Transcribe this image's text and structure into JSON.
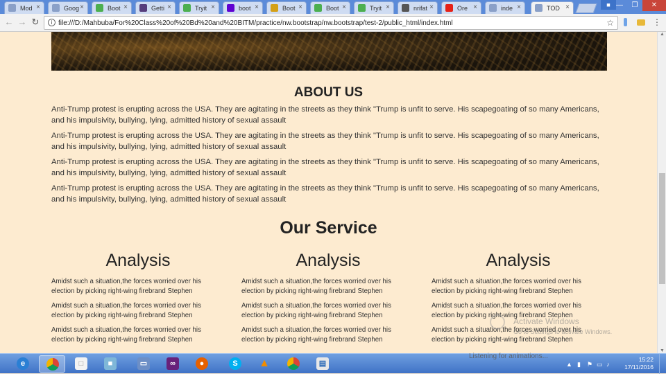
{
  "browser": {
    "tabs": [
      {
        "label": "Mod",
        "icon": "page-icon",
        "color": "#8aa0c8"
      },
      {
        "label": "Goog",
        "icon": "page-icon",
        "color": "#8aa0c8"
      },
      {
        "label": "Boot",
        "icon": "w3schools-icon",
        "color": "#4caf50"
      },
      {
        "label": "Getti",
        "icon": "bootstrap-icon",
        "color": "#563d7c"
      },
      {
        "label": "Tryit",
        "icon": "w3schools-icon",
        "color": "#4caf50"
      },
      {
        "label": "boot",
        "icon": "yahoo-icon",
        "color": "#5f01d1"
      },
      {
        "label": "Boot",
        "icon": "coin-icon",
        "color": "#d4a017"
      },
      {
        "label": "Boot",
        "icon": "w3schools-icon",
        "color": "#4caf50"
      },
      {
        "label": "Tryit",
        "icon": "w3schools-icon",
        "color": "#4caf50"
      },
      {
        "label": "nrifat",
        "icon": "github-icon",
        "color": "#555"
      },
      {
        "label": "Ore",
        "icon": "youtube-icon",
        "color": "#e62117"
      },
      {
        "label": "inde",
        "icon": "page-icon",
        "color": "#8aa0c8"
      },
      {
        "label": "TOD",
        "icon": "page-icon",
        "color": "#8aa0c8"
      }
    ],
    "url": "file:///D:/Mahbuba/For%20Class%20of%20Bd%20and%20BITM/practice/nw.bootstrap/nw.bootstrap/test-2/public_html/index.html"
  },
  "about": {
    "title": "ABOUT US",
    "paragraphs": [
      "Anti-Trump protest is erupting across the USA. They are agitating in the streets as they think \"Trump is unfit to serve. His scapegoating of so many Americans, and his impulsivity, bullying, lying, admitted history of sexual assault",
      "Anti-Trump protest is erupting across the USA. They are agitating in the streets as they think \"Trump is unfit to serve. His scapegoating of so many Americans, and his impulsivity, bullying, lying, admitted history of sexual assault",
      "Anti-Trump protest is erupting across the USA. They are agitating in the streets as they think \"Trump is unfit to serve. His scapegoating of so many Americans, and his impulsivity, bullying, lying, admitted history of sexual assault",
      "Anti-Trump protest is erupting across the USA. They are agitating in the streets as they think \"Trump is unfit to serve. His scapegoating of so many Americans, and his impulsivity, bullying, lying, admitted history of sexual assault"
    ]
  },
  "service": {
    "title": "Our Service",
    "columns": [
      {
        "heading": "Analysis",
        "items": [
          "Amidst such a situation,the forces worried over his election by picking right-wing firebrand Stephen",
          "Amidst such a situation,the forces worried over his election by picking right-wing firebrand Stephen",
          "Amidst such a situation,the forces worried over his election by picking right-wing firebrand Stephen"
        ]
      },
      {
        "heading": "Analysis",
        "items": [
          "Amidst such a situation,the forces worried over his election by picking right-wing firebrand Stephen",
          "Amidst such a situation,the forces worried over his election by picking right-wing firebrand Stephen",
          "Amidst such a situation,the forces worried over his election by picking right-wing firebrand Stephen"
        ]
      },
      {
        "heading": "Analysis",
        "items": [
          "Amidst such a situation,the forces worried over his election by picking right-wing firebrand Stephen",
          "Amidst such a situation,the forces worried over his election by picking right-wing firebrand Stephen",
          "Amidst such a situation,the forces worried over his election by picking right-wing firebrand Stephen"
        ]
      }
    ]
  },
  "watermark": {
    "line1": "Activate Windows",
    "line2": "Go to Settings to activate Windows."
  },
  "status": "Listening for animations...",
  "taskbar": {
    "apps": [
      "ie-icon",
      "chrome-icon",
      "file-icon",
      "photo-icon",
      "virtualbox-icon",
      "visual-studio-icon",
      "firefox-icon",
      "skype-icon",
      "vlc-icon",
      "chrome-icon",
      "presentation-icon"
    ],
    "time": "15:22",
    "date": "17/11/2016"
  }
}
